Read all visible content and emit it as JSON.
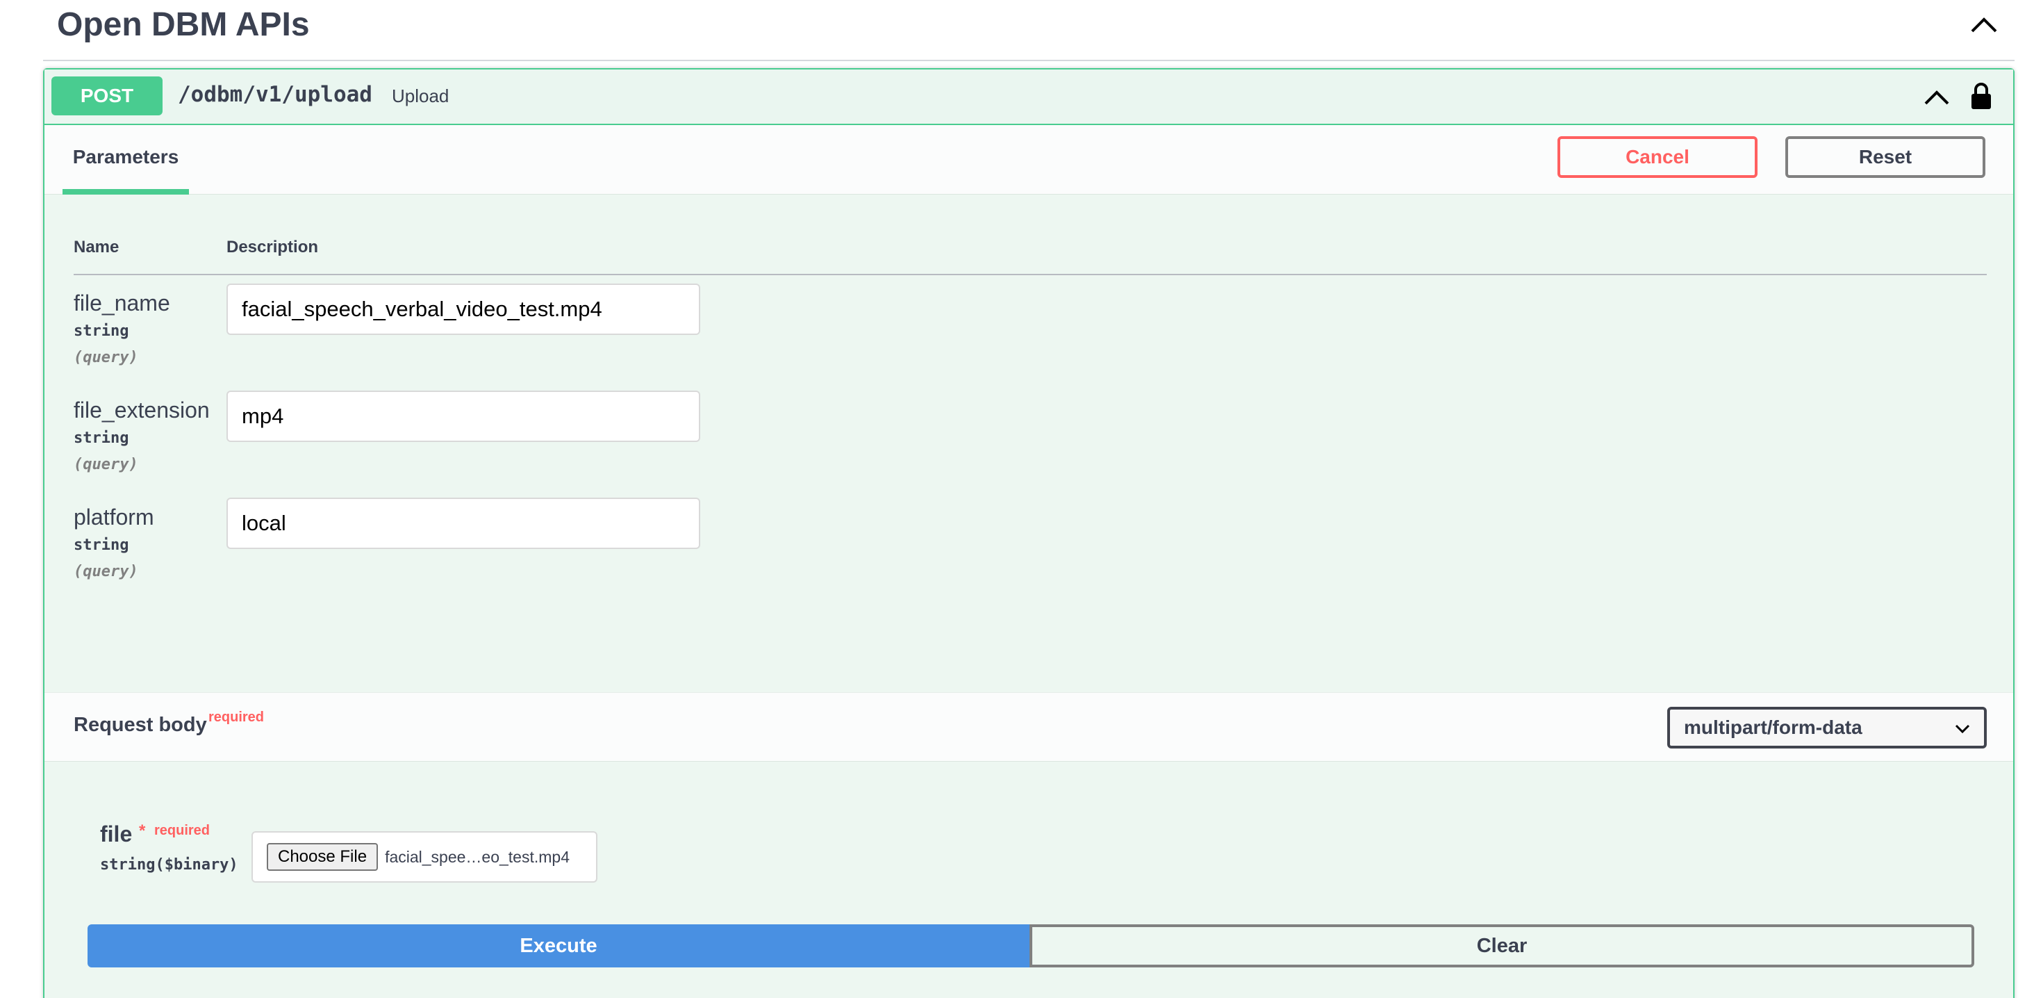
{
  "tag": {
    "title": "Open DBM APIs",
    "collapse_icon": "chevron-up-icon"
  },
  "operation": {
    "method": "POST",
    "path": "/odbm/v1/upload",
    "summary": "Upload",
    "method_color": "#49cc90",
    "collapse_icon": "chevron-up-icon",
    "lock_icon": "lock-icon"
  },
  "parameters": {
    "tab_label": "Parameters",
    "cancel_label": "Cancel",
    "reset_label": "Reset",
    "columns": {
      "name": "Name",
      "description": "Description"
    },
    "items": [
      {
        "name": "file_name",
        "type": "string",
        "in": "(query)",
        "value": "facial_speech_verbal_video_test.mp4"
      },
      {
        "name": "file_extension",
        "type": "string",
        "in": "(query)",
        "value": "mp4"
      },
      {
        "name": "platform",
        "type": "string",
        "in": "(query)",
        "value": "local"
      }
    ]
  },
  "request_body": {
    "title": "Request body",
    "required_label": "required",
    "content_type": "multipart/form-data",
    "file_field": {
      "name": "file",
      "star": "*",
      "required_label": "required",
      "type": "string($binary)",
      "choose_label": "Choose File",
      "chosen_file": "facial_spee…eo_test.mp4"
    }
  },
  "actions": {
    "execute_label": "Execute",
    "clear_label": "Clear",
    "execute_color": "#4990e2"
  }
}
